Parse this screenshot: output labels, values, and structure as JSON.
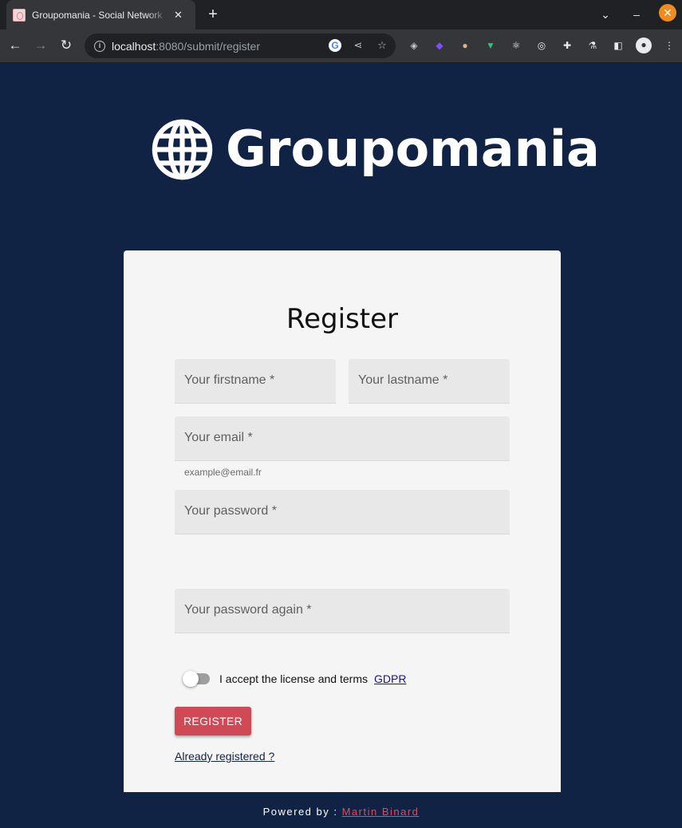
{
  "browser": {
    "tab_title": "Groupomania - Social Network",
    "tab_close": "✕",
    "new_tab": "+",
    "url_host": "localhost",
    "url_path": ":8080/submit/register",
    "minimize": "–",
    "close": "✕"
  },
  "logo": {
    "text": "Groupomania"
  },
  "form": {
    "title": "Register",
    "firstname_placeholder": "Your firstname *",
    "lastname_placeholder": "Your lastname *",
    "email_placeholder": "Your email *",
    "email_hint": "example@email.fr",
    "password_placeholder": "Your password *",
    "password_again_placeholder": "Your password again *",
    "terms_label": "I accept the license and terms",
    "gdpr_link": "GDPR",
    "register_button": "REGISTER",
    "already_registered_link": "Already registered ?"
  },
  "footer": {
    "prefix": "Powered by :",
    "author": "Martin Binard"
  },
  "colors": {
    "page_bg": "#112344",
    "card_bg": "#f5f5f5",
    "accent": "#d04a56",
    "footer_link": "#e04b5d"
  }
}
